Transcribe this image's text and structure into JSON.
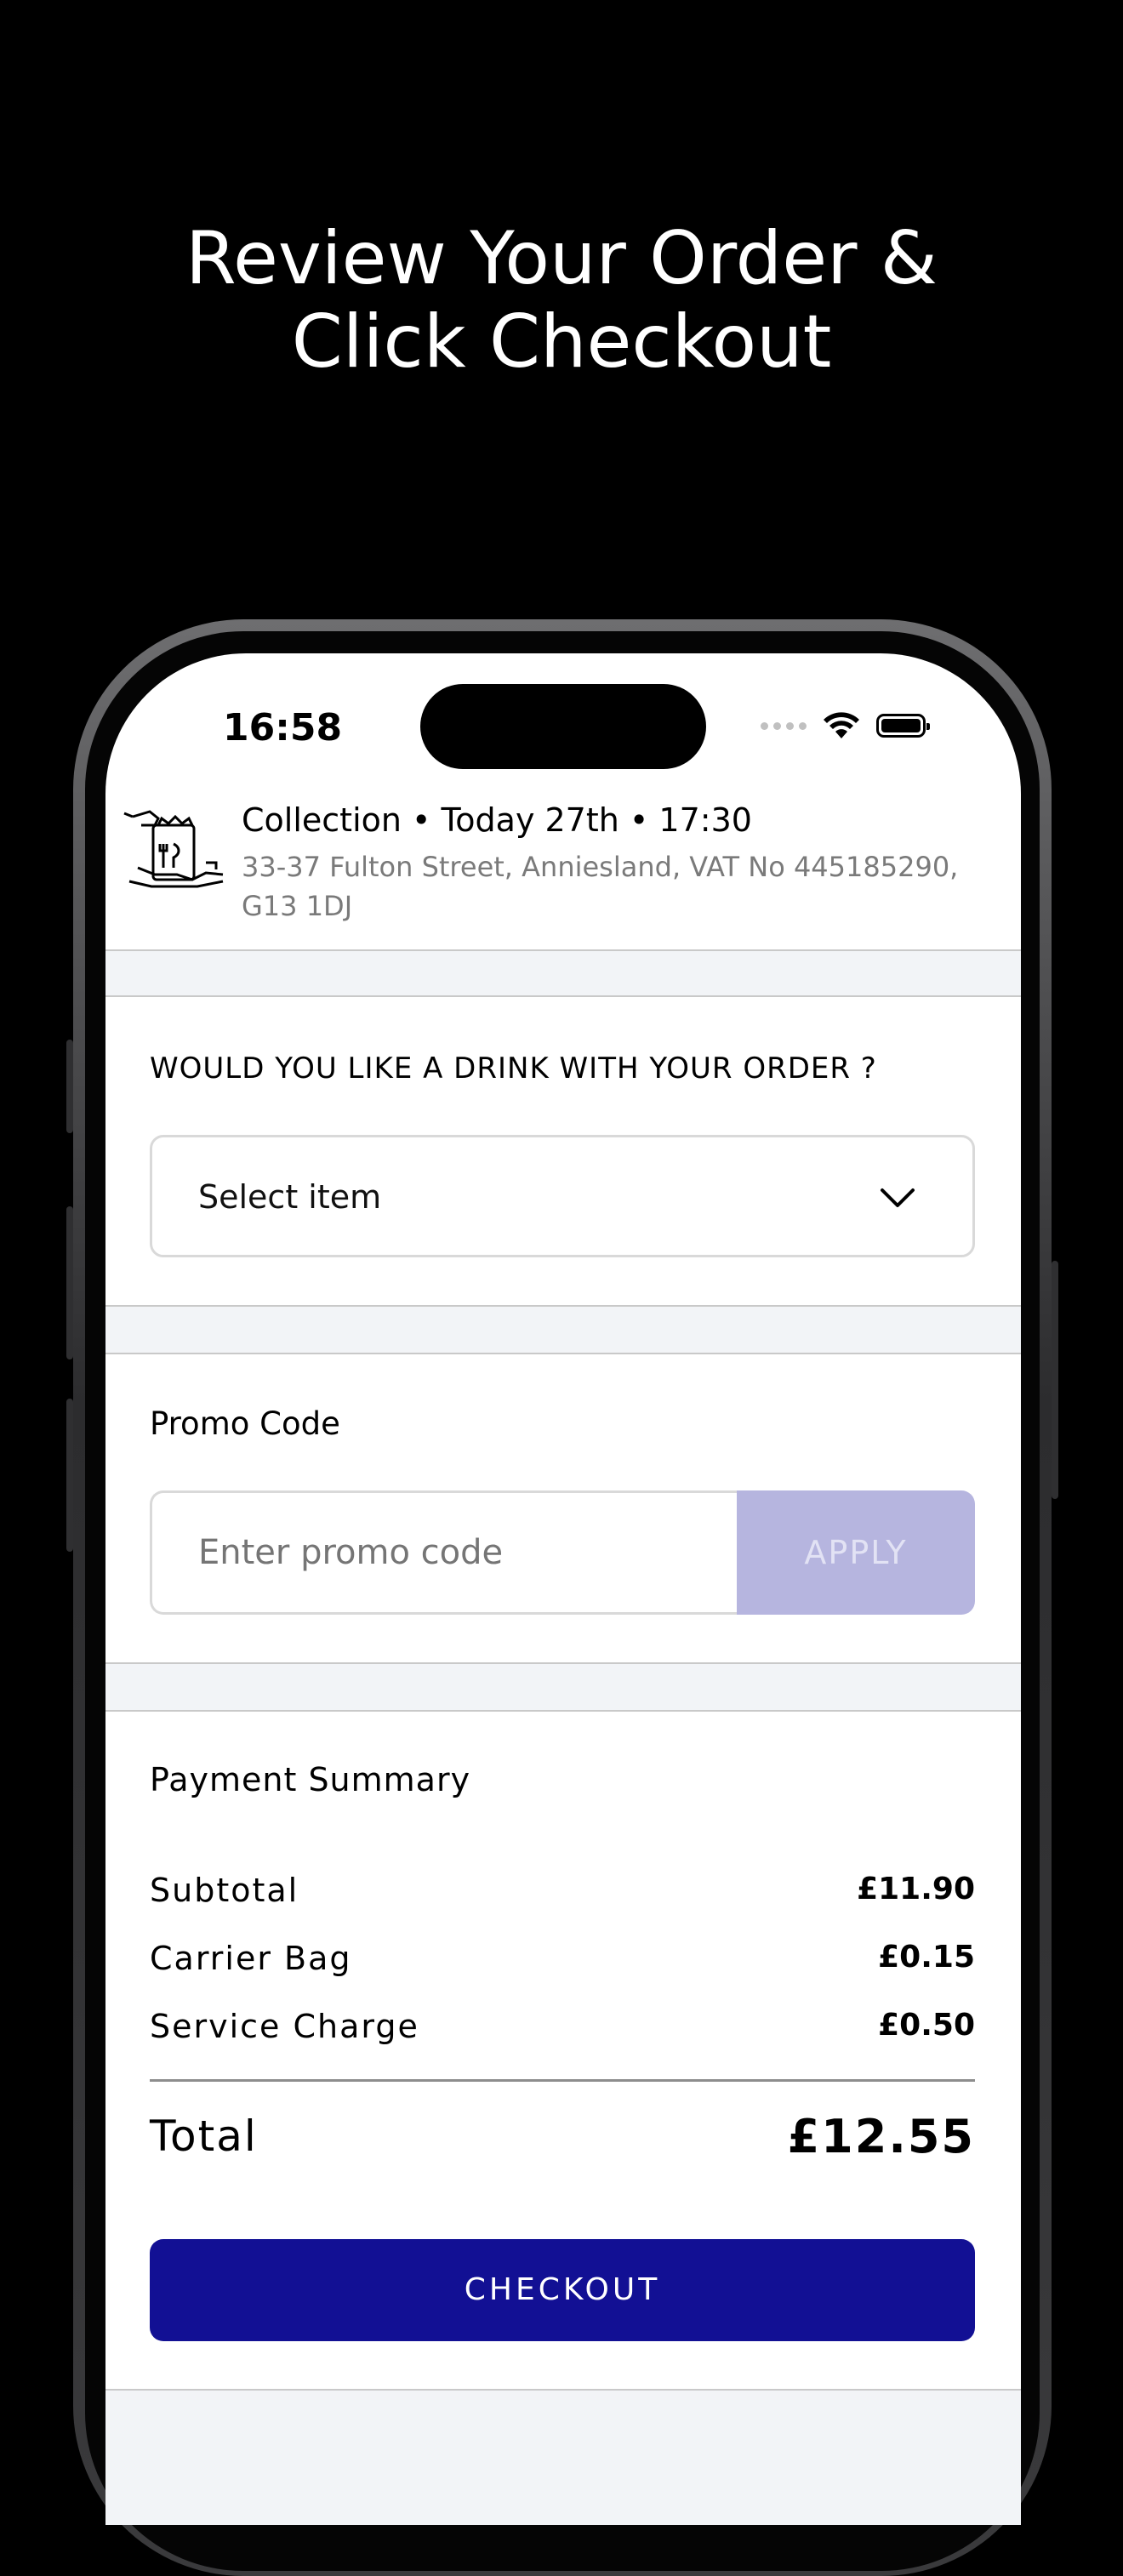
{
  "headline": {
    "line1": "Review Your Order &",
    "line2": "Click Checkout"
  },
  "status_bar": {
    "time": "16:58"
  },
  "collection": {
    "title": "Collection • Today 27th • 17:30",
    "address": "33-37 Fulton Street, Anniesland, VAT No 445185290, G13  1DJ",
    "icon": "collection-bag-icon"
  },
  "drink": {
    "question": "WOULD YOU LIKE A DRINK WITH YOUR ORDER ?",
    "select_value": "Select item"
  },
  "promo": {
    "label": "Promo Code",
    "placeholder": "Enter promo code",
    "apply_label": "APPLY"
  },
  "payment": {
    "title": "Payment Summary",
    "rows": [
      {
        "label": "Subtotal",
        "value": "£11.90"
      },
      {
        "label": "Carrier Bag",
        "value": "£0.15"
      },
      {
        "label": "Service Charge",
        "value": "£0.50"
      }
    ],
    "total_label": "Total",
    "total_value": "£12.55",
    "checkout_label": "CHECKOUT"
  },
  "colors": {
    "brand": "#121094",
    "apply_disabled": "#b6b5df",
    "band": "#f2f4f7"
  }
}
